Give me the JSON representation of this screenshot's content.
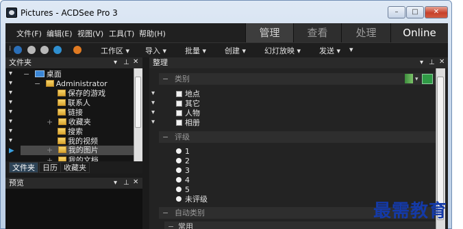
{
  "window": {
    "title": "Pictures - ACDSee Pro 3",
    "minimize": "–",
    "maximize": "□",
    "close": "✕"
  },
  "menu": [
    "文件(F)",
    "编辑(E)",
    "视图(V)",
    "工具(T)",
    "帮助(H)"
  ],
  "modes": [
    "管理",
    "查看",
    "处理",
    "Online"
  ],
  "toolbar": {
    "workspace": "工作区 ▾",
    "import": "导入 ▾",
    "batch": "批量 ▾",
    "create": "创建 ▾",
    "slideshow": "幻灯放映 ▾",
    "send": "发送 ▾",
    "more": "▾"
  },
  "colors": {
    "dark_bg": "#1a1a1a",
    "accent_blue": "#2d4356",
    "watermark": "#143aa8"
  },
  "folders_pane": {
    "title": "文件夹",
    "tree": [
      {
        "label": "桌面",
        "expand": "−"
      },
      {
        "label": "Administrator",
        "expand": "−"
      },
      {
        "label": "保存的游戏",
        "expand": ""
      },
      {
        "label": "联系人",
        "expand": ""
      },
      {
        "label": "链接",
        "expand": ""
      },
      {
        "label": "收藏夹",
        "expand": "+"
      },
      {
        "label": "搜索",
        "expand": ""
      },
      {
        "label": "我的视频",
        "expand": ""
      },
      {
        "label": "我的图片",
        "expand": "+"
      },
      {
        "label": "我的文档",
        "expand": "+"
      }
    ],
    "tabs": [
      "文件夹",
      "日历",
      "收藏夹"
    ]
  },
  "preview_pane": {
    "title": "预览"
  },
  "organize_pane": {
    "title": "整理",
    "categories_header": "类别",
    "categories": [
      "地点",
      "其它",
      "人物",
      "相册"
    ],
    "rating_header": "评级",
    "ratings": [
      "1",
      "2",
      "3",
      "4",
      "5",
      "未评级"
    ],
    "auto_categories_header": "自动类别",
    "common_header": "常用"
  },
  "watermark": "最需教育"
}
